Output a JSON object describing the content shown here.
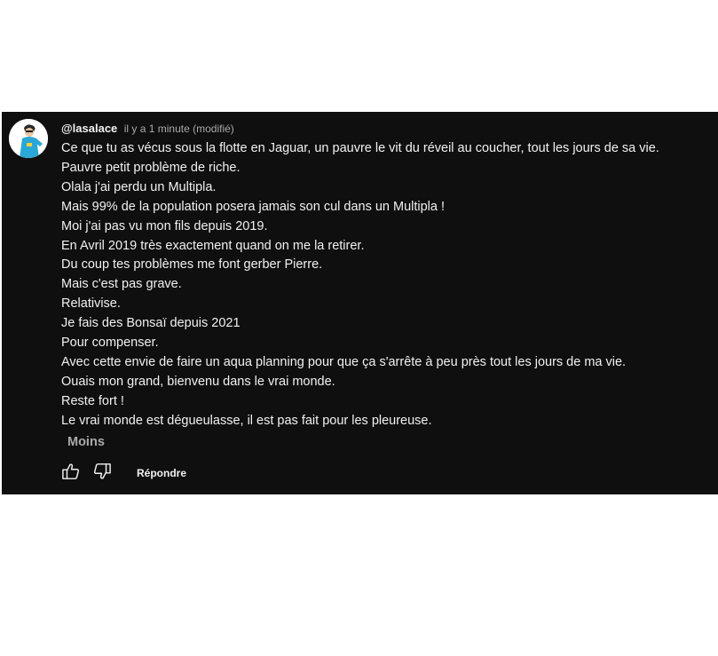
{
  "comment": {
    "author": "@lasalace",
    "timestamp": "il y a 1 minute (modifié)",
    "lines": [
      "Ce que tu as vécus sous la flotte en Jaguar, un pauvre le vit du réveil au coucher, tout les jours de sa vie.",
      "Pauvre petit problème de riche.",
      "Olala j'ai perdu un Multipla.",
      "Mais 99% de la population posera jamais son cul dans un Multipla !",
      "Moi j'ai pas vu mon fils depuis 2019.",
      "En Avril 2019 très exactement quand on me la retirer.",
      "Du coup tes problèmes me font gerber Pierre.",
      "Mais c'est pas grave.",
      "Relativise.",
      "Je fais des Bonsaï depuis 2021",
      "Pour compenser.",
      "Avec cette envie de faire un aqua planning pour que ça s'arrête à peu près tout les jours de ma vie.",
      "Ouais mon grand, bienvenu dans le vrai monde.",
      "Reste fort !",
      "Le vrai monde est dégueulasse, il est pas fait pour les pleureuse."
    ],
    "less_label": "Moins",
    "reply_label": "Répondre",
    "icons": {
      "like": "thumbs-up-icon",
      "dislike": "thumbs-down-icon"
    }
  },
  "colors": {
    "card_background": "#0f0f0f",
    "text_primary": "#f1f1f1",
    "text_secondary": "#aaaaaa"
  }
}
